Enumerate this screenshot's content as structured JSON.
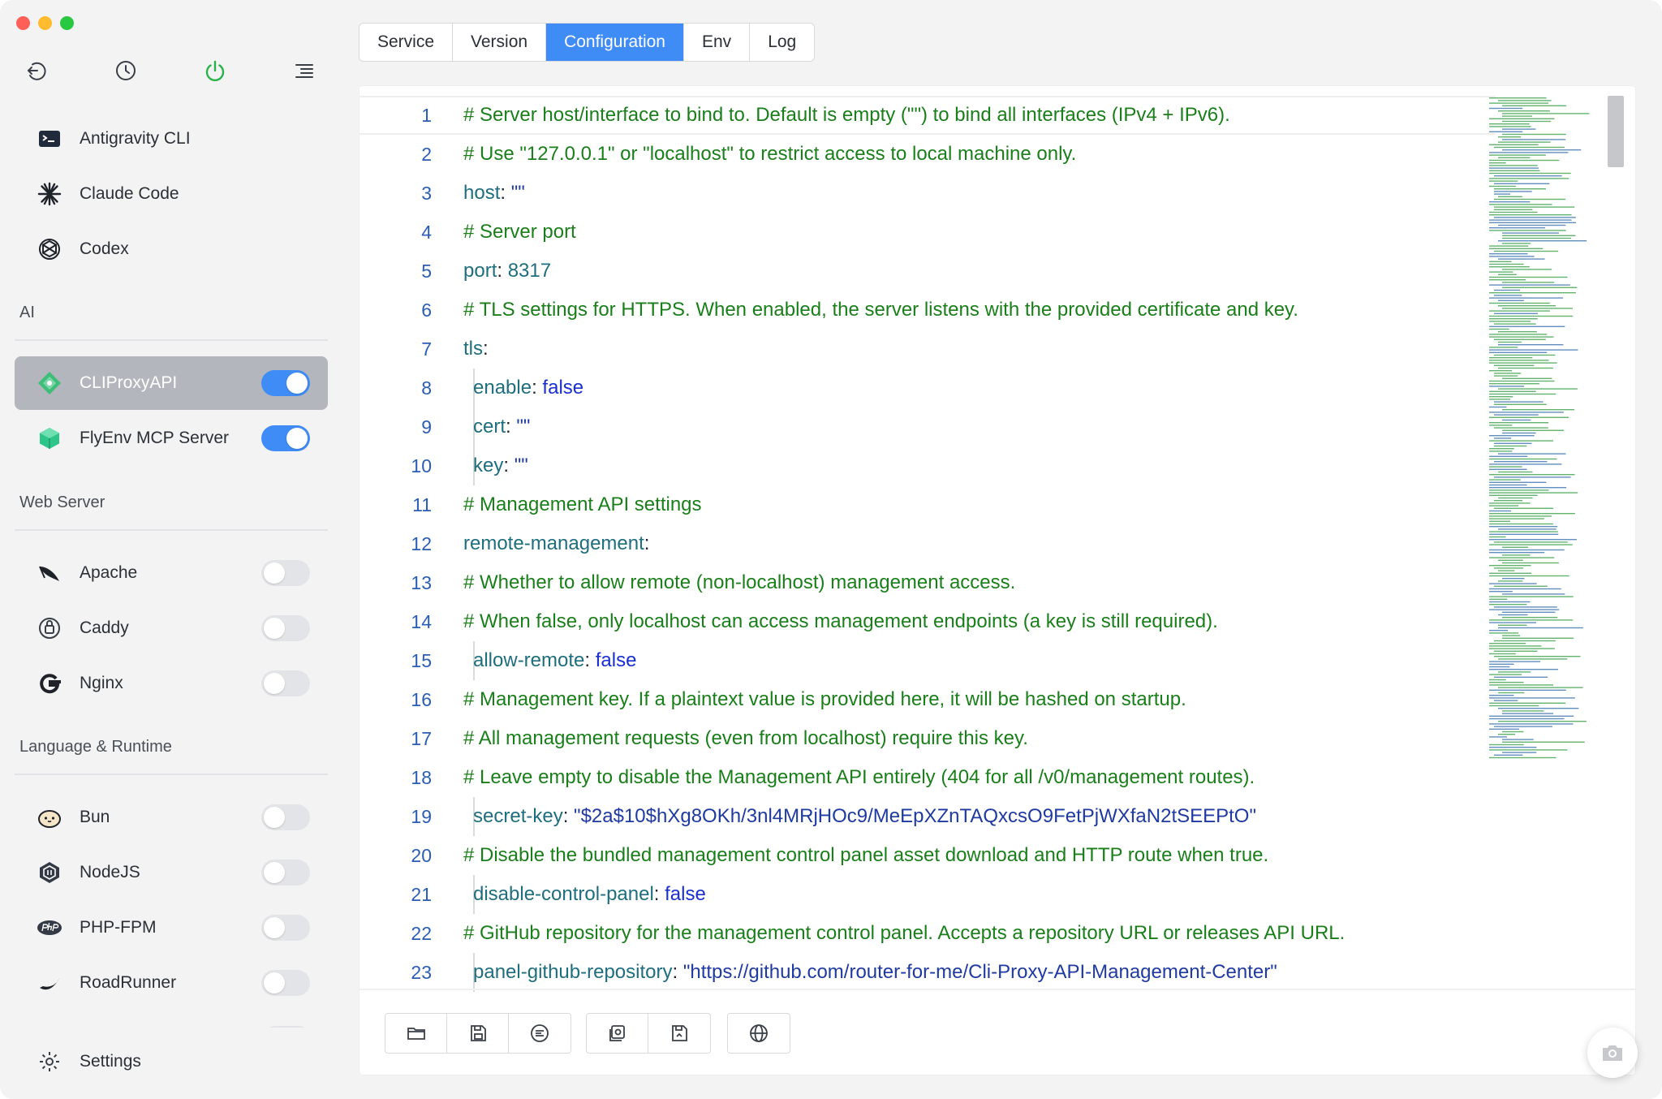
{
  "window": {
    "controls": [
      "close",
      "minimize",
      "zoom"
    ]
  },
  "sidebar": {
    "top_icons": [
      {
        "name": "back-icon"
      },
      {
        "name": "history-clock-icon"
      },
      {
        "name": "power-icon",
        "color": "#28b34a"
      },
      {
        "name": "menu-list-icon"
      }
    ],
    "items": [
      {
        "label": "Antigravity CLI",
        "icon": "terminal-icon"
      },
      {
        "label": "Claude Code",
        "icon": "claude-asterisk-icon"
      },
      {
        "label": "Codex",
        "icon": "openai-knot-icon"
      }
    ],
    "sections": [
      {
        "title": "AI",
        "items": [
          {
            "label": "CLIProxyAPI",
            "icon": "diamond-logo-icon",
            "enabled": true,
            "active": true
          },
          {
            "label": "FlyEnv MCP Server",
            "icon": "cube-icon",
            "enabled": true,
            "active": false
          }
        ]
      },
      {
        "title": "Web Server",
        "items": [
          {
            "label": "Apache",
            "icon": "apache-feather-icon",
            "enabled": false
          },
          {
            "label": "Caddy",
            "icon": "caddy-icon",
            "enabled": false
          },
          {
            "label": "Nginx",
            "icon": "nginx-g-icon",
            "enabled": false
          }
        ]
      },
      {
        "title": "Language & Runtime",
        "items": [
          {
            "label": "Bun",
            "icon": "bun-icon",
            "enabled": false
          },
          {
            "label": "NodeJS",
            "icon": "nodejs-hexagon-icon",
            "enabled": false
          },
          {
            "label": "PHP-FPM",
            "icon": "php-icon",
            "enabled": false
          },
          {
            "label": "RoadRunner",
            "icon": "roadrunner-icon",
            "enabled": false
          }
        ]
      }
    ],
    "settings_label": "Settings",
    "toggle_on_color": "#3f8cf7",
    "active_item_bg": "#b3b6bc"
  },
  "tabs": [
    {
      "label": "Service",
      "active": false
    },
    {
      "label": "Version",
      "active": false
    },
    {
      "label": "Configuration",
      "active": true
    },
    {
      "label": "Env",
      "active": false
    },
    {
      "label": "Log",
      "active": false
    }
  ],
  "editor": {
    "current_line": 1,
    "lines": [
      {
        "n": "1",
        "indent": false,
        "tokens": [
          {
            "t": "# Server host/interface to bind to. Default is empty (\"\") to bind all interfaces (IPv4 + IPv6).",
            "c": "comment"
          }
        ]
      },
      {
        "n": "2",
        "indent": false,
        "tokens": [
          {
            "t": "# Use \"127.0.0.1\" or \"localhost\" to restrict access to local machine only.",
            "c": "comment"
          }
        ]
      },
      {
        "n": "3",
        "indent": false,
        "tokens": [
          {
            "t": "host",
            "c": "key"
          },
          {
            "t": ": ",
            "c": "punct"
          },
          {
            "t": "\"\"",
            "c": "str"
          }
        ]
      },
      {
        "n": "4",
        "indent": false,
        "tokens": [
          {
            "t": "# Server port",
            "c": "comment"
          }
        ]
      },
      {
        "n": "5",
        "indent": false,
        "tokens": [
          {
            "t": "port",
            "c": "key"
          },
          {
            "t": ": ",
            "c": "punct"
          },
          {
            "t": "8317",
            "c": "num"
          }
        ]
      },
      {
        "n": "6",
        "indent": false,
        "tokens": [
          {
            "t": "# TLS settings for HTTPS. When enabled, the server listens with the provided certificate and key.",
            "c": "comment"
          }
        ]
      },
      {
        "n": "7",
        "indent": false,
        "tokens": [
          {
            "t": "tls",
            "c": "key"
          },
          {
            "t": ":",
            "c": "punct"
          }
        ]
      },
      {
        "n": "8",
        "indent": true,
        "tokens": [
          {
            "t": "enable",
            "c": "key"
          },
          {
            "t": ": ",
            "c": "punct"
          },
          {
            "t": "false",
            "c": "bool"
          }
        ]
      },
      {
        "n": "9",
        "indent": true,
        "tokens": [
          {
            "t": "cert",
            "c": "key"
          },
          {
            "t": ": ",
            "c": "punct"
          },
          {
            "t": "\"\"",
            "c": "str"
          }
        ]
      },
      {
        "n": "10",
        "indent": true,
        "tokens": [
          {
            "t": "key",
            "c": "key"
          },
          {
            "t": ": ",
            "c": "punct"
          },
          {
            "t": "\"\"",
            "c": "str"
          }
        ]
      },
      {
        "n": "11",
        "indent": false,
        "tokens": [
          {
            "t": "# Management API settings",
            "c": "comment"
          }
        ]
      },
      {
        "n": "12",
        "indent": false,
        "tokens": [
          {
            "t": "remote-management",
            "c": "key"
          },
          {
            "t": ":",
            "c": "punct"
          }
        ]
      },
      {
        "n": "13",
        "indent": false,
        "tokens": [
          {
            "t": "# Whether to allow remote (non-localhost) management access.",
            "c": "comment"
          }
        ]
      },
      {
        "n": "14",
        "indent": false,
        "tokens": [
          {
            "t": "# When false, only localhost can access management endpoints (a key is still required).",
            "c": "comment"
          }
        ]
      },
      {
        "n": "15",
        "indent": true,
        "tokens": [
          {
            "t": "allow-remote",
            "c": "key"
          },
          {
            "t": ": ",
            "c": "punct"
          },
          {
            "t": "false",
            "c": "bool"
          }
        ]
      },
      {
        "n": "16",
        "indent": false,
        "tokens": [
          {
            "t": "# Management key. If a plaintext value is provided here, it will be hashed on startup.",
            "c": "comment"
          }
        ]
      },
      {
        "n": "17",
        "indent": false,
        "tokens": [
          {
            "t": "# All management requests (even from localhost) require this key.",
            "c": "comment"
          }
        ]
      },
      {
        "n": "18",
        "indent": false,
        "tokens": [
          {
            "t": "# Leave empty to disable the Management API entirely (404 for all /v0/management routes).",
            "c": "comment"
          }
        ]
      },
      {
        "n": "19",
        "indent": true,
        "tokens": [
          {
            "t": "secret-key",
            "c": "key"
          },
          {
            "t": ": ",
            "c": "punct"
          },
          {
            "t": "\"$2a$10$hXg8OKh/3nl4MRjHOc9/MeEpXZnTAQxcsO9FetPjWXfaN2tSEEPtO\"",
            "c": "str"
          }
        ]
      },
      {
        "n": "20",
        "indent": false,
        "tokens": [
          {
            "t": "# Disable the bundled management control panel asset download and HTTP route when true.",
            "c": "comment"
          }
        ]
      },
      {
        "n": "21",
        "indent": true,
        "tokens": [
          {
            "t": "disable-control-panel",
            "c": "key"
          },
          {
            "t": ": ",
            "c": "punct"
          },
          {
            "t": "false",
            "c": "bool"
          }
        ]
      },
      {
        "n": "22",
        "indent": false,
        "tokens": [
          {
            "t": "# GitHub repository for the management control panel. Accepts a repository URL or releases API URL.",
            "c": "comment"
          }
        ]
      },
      {
        "n": "23",
        "indent": true,
        "tokens": [
          {
            "t": "panel-github-repository",
            "c": "key"
          },
          {
            "t": ": ",
            "c": "punct"
          },
          {
            "t": "\"https://github.com/router-for-me/Cli-Proxy-API-Management-Center\"",
            "c": "str"
          }
        ]
      }
    ]
  },
  "toolbar": {
    "groups": [
      [
        {
          "name": "open-folder-icon"
        },
        {
          "name": "save-icon"
        },
        {
          "name": "format-list-icon"
        }
      ],
      [
        {
          "name": "load-config-icon"
        },
        {
          "name": "save-as-icon"
        }
      ],
      [
        {
          "name": "globe-icon"
        }
      ]
    ]
  },
  "floating_button": {
    "name": "camera-screenshot-icon"
  }
}
